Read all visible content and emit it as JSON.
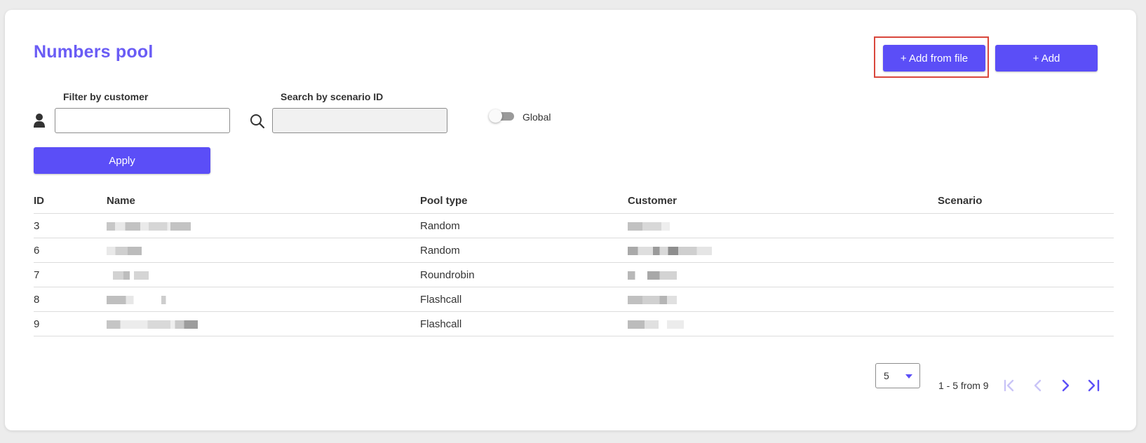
{
  "page": {
    "title": "Numbers pool"
  },
  "actions": {
    "add_from_file_label": "+ Add from file",
    "add_label": "+ Add"
  },
  "filters": {
    "customer_label": "Filter by customer",
    "customer_value": "",
    "scenario_label": "Search by scenario ID",
    "scenario_value": "",
    "global_label": "Global",
    "global_enabled": false,
    "apply_label": "Apply"
  },
  "icons": {
    "customer": "user-icon",
    "scenario": "search-icon"
  },
  "table": {
    "columns": [
      "ID",
      "Name",
      "Pool type",
      "Customer",
      "Scenario"
    ],
    "rows": [
      {
        "id": "3",
        "pool_type": "Random",
        "scenario": ""
      },
      {
        "id": "6",
        "pool_type": "Random",
        "scenario": ""
      },
      {
        "id": "7",
        "pool_type": "Roundrobin",
        "scenario": ""
      },
      {
        "id": "8",
        "pool_type": "Flashcall",
        "scenario": ""
      },
      {
        "id": "9",
        "pool_type": "Flashcall",
        "scenario": ""
      }
    ]
  },
  "pagination": {
    "page_size": "5",
    "range_text": "1 - 5 from 9"
  },
  "colors": {
    "accent": "#5b4ef7",
    "title": "#6a5cf5",
    "highlight": "#d9473c"
  }
}
